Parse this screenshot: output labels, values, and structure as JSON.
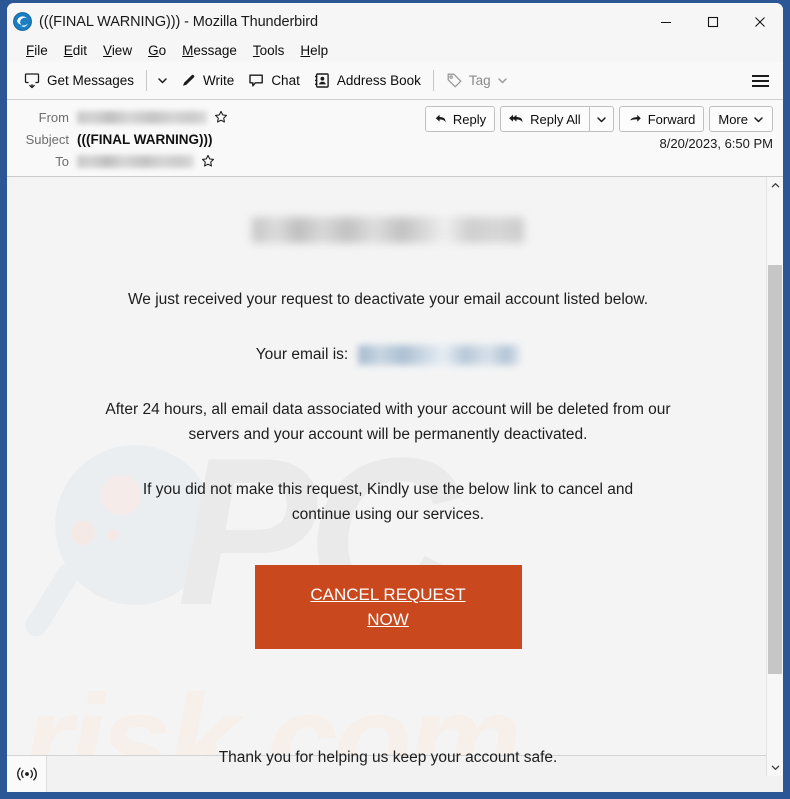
{
  "window": {
    "title": "(((FINAL WARNING))) - Mozilla Thunderbird",
    "logo_icon": "thunderbird-logo-icon",
    "controls": {
      "minimize": "minimize-icon",
      "maximize": "maximize-icon",
      "close": "close-icon"
    }
  },
  "menubar": {
    "items": [
      {
        "label": "File",
        "access": "F"
      },
      {
        "label": "Edit",
        "access": "E"
      },
      {
        "label": "View",
        "access": "V"
      },
      {
        "label": "Go",
        "access": "G"
      },
      {
        "label": "Message",
        "access": "M"
      },
      {
        "label": "Tools",
        "access": "T"
      },
      {
        "label": "Help",
        "access": "H"
      }
    ]
  },
  "toolbar": {
    "get_messages": "Get Messages",
    "get_messages_icon": "download-mail-icon",
    "get_messages_caret": "chevron-down-icon",
    "write": "Write",
    "write_icon": "pencil-icon",
    "chat": "Chat",
    "chat_icon": "speech-bubble-icon",
    "address_book": "Address Book",
    "address_book_icon": "contact-card-icon",
    "tag": "Tag",
    "tag_icon": "tag-icon",
    "tag_caret": "chevron-down-icon",
    "app_menu_icon": "hamburger-menu-icon"
  },
  "message_header": {
    "from_label": "From",
    "from_value_redacted": true,
    "from_star_icon": "star-outline-icon",
    "subject_label": "Subject",
    "subject_value": "(((FINAL WARNING)))",
    "to_label": "To",
    "to_value_redacted": true,
    "to_star_icon": "star-outline-icon",
    "date": "8/20/2023, 6:50 PM",
    "actions": {
      "reply": "Reply",
      "reply_icon": "reply-arrow-icon",
      "reply_all": "Reply All",
      "reply_all_icon": "reply-all-arrow-icon",
      "reply_all_caret": "chevron-down-icon",
      "forward": "Forward",
      "forward_icon": "forward-arrow-icon",
      "more": "More",
      "more_caret": "chevron-down-icon"
    }
  },
  "email_body": {
    "brand_redacted": true,
    "paragraph_1": "We just received your request to deactivate your email account listed below.",
    "your_email_label": "Your email is:",
    "your_email_redacted": true,
    "paragraph_2_line_1": "After 24 hours, all email data associated with your account will be deleted from our",
    "paragraph_2_line_2": "servers and your account will be permanently deactivated.",
    "paragraph_3_line_1": "If you did not make this request, Kindly use the below link to cancel and",
    "paragraph_3_line_2": "continue using our services.",
    "cta_label_line_1": "CANCEL REQUEST",
    "cta_label_line_2": "NOW",
    "cta_color": "#c9481e",
    "footer": "Thank you for helping us keep your account safe.",
    "watermark_primary": "PC",
    "watermark_secondary": "risk.com"
  },
  "scrollbar": {
    "up_icon": "chevron-up-icon",
    "down_icon": "chevron-down-icon",
    "thumb": "scroll-thumb"
  },
  "statusbar": {
    "connection_icon": "online-status-icon",
    "text": ""
  },
  "colors": {
    "window_frame": "#2b5797",
    "accent_cta": "#c9481e",
    "toolbar_bg": "#f9f9f9",
    "body_bg": "#f4f4f4"
  }
}
